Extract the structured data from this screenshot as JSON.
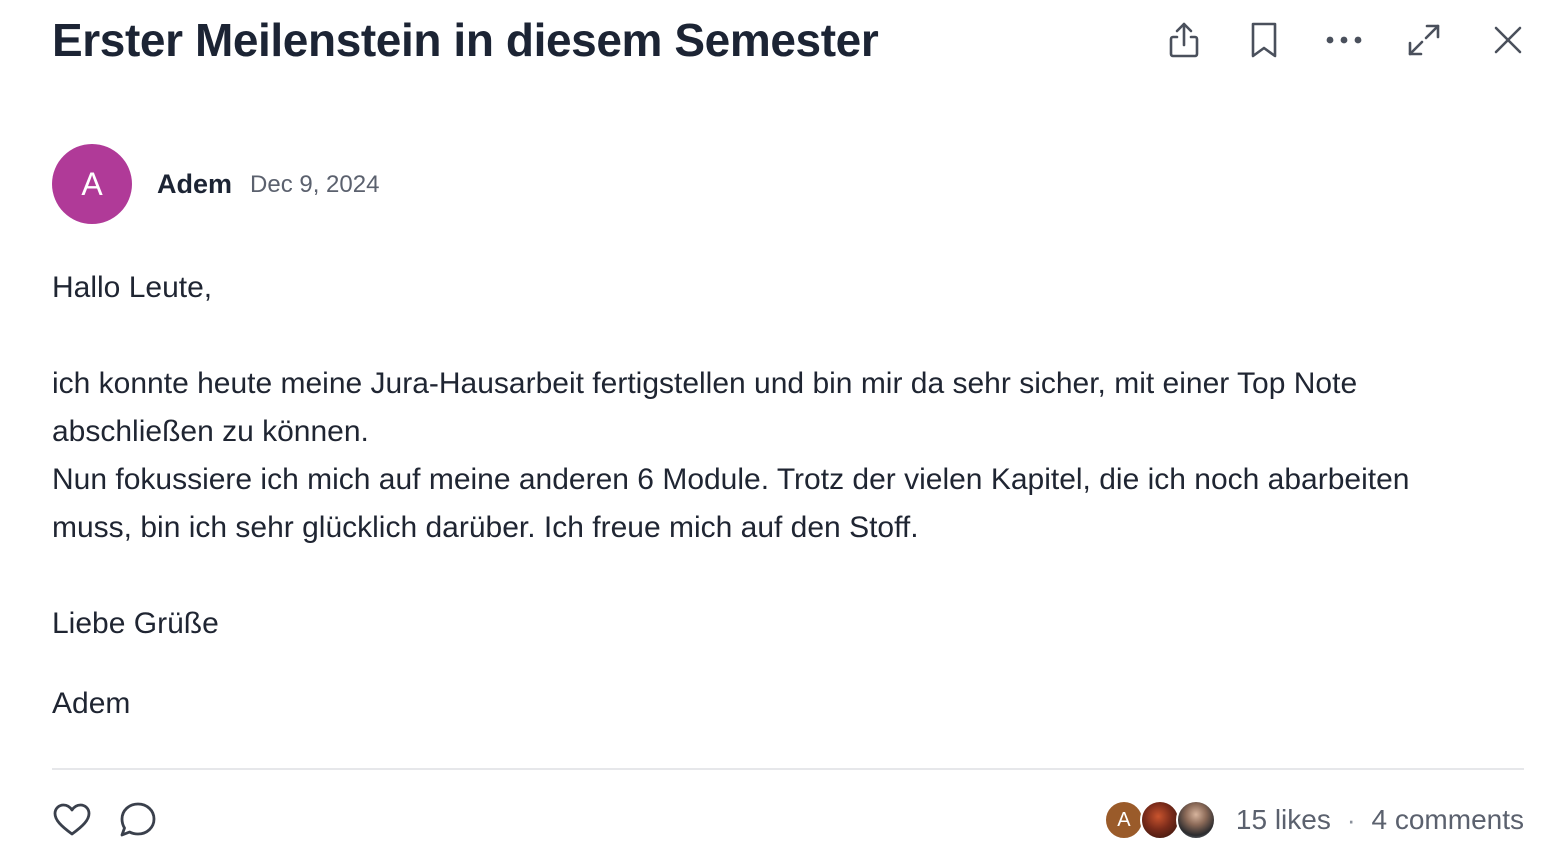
{
  "post": {
    "title": "Erster Meilenstein in diesem Semester",
    "author": {
      "initial": "A",
      "name": "Adem",
      "avatar_color": "#b03a98"
    },
    "date": "Dec 9, 2024",
    "body": {
      "greeting": "Hallo Leute,",
      "line1": "ich konnte heute meine Jura-Hausarbeit fertigstellen und bin mir da sehr sicher, mit einer Top Note abschließen zu können.",
      "line2": "Nun fokussiere ich mich auf meine anderen 6 Module. Trotz der vielen Kapitel, die ich noch abarbeiten muss, bin ich sehr glücklich darüber. Ich freue mich auf den Stoff.",
      "closing": "Liebe Grüße",
      "signature": "Adem"
    }
  },
  "toolbar": {
    "icons": [
      "share-icon",
      "bookmark-icon",
      "more-icon",
      "expand-icon",
      "close-icon"
    ]
  },
  "footer": {
    "icons": [
      "heart-icon",
      "comment-icon"
    ],
    "likers": [
      {
        "initial": "A",
        "color": "#9a5b2a"
      },
      {
        "kind": "photo"
      },
      {
        "kind": "photo"
      }
    ],
    "likes": "15 likes",
    "separator": "·",
    "comments": "4 comments"
  }
}
